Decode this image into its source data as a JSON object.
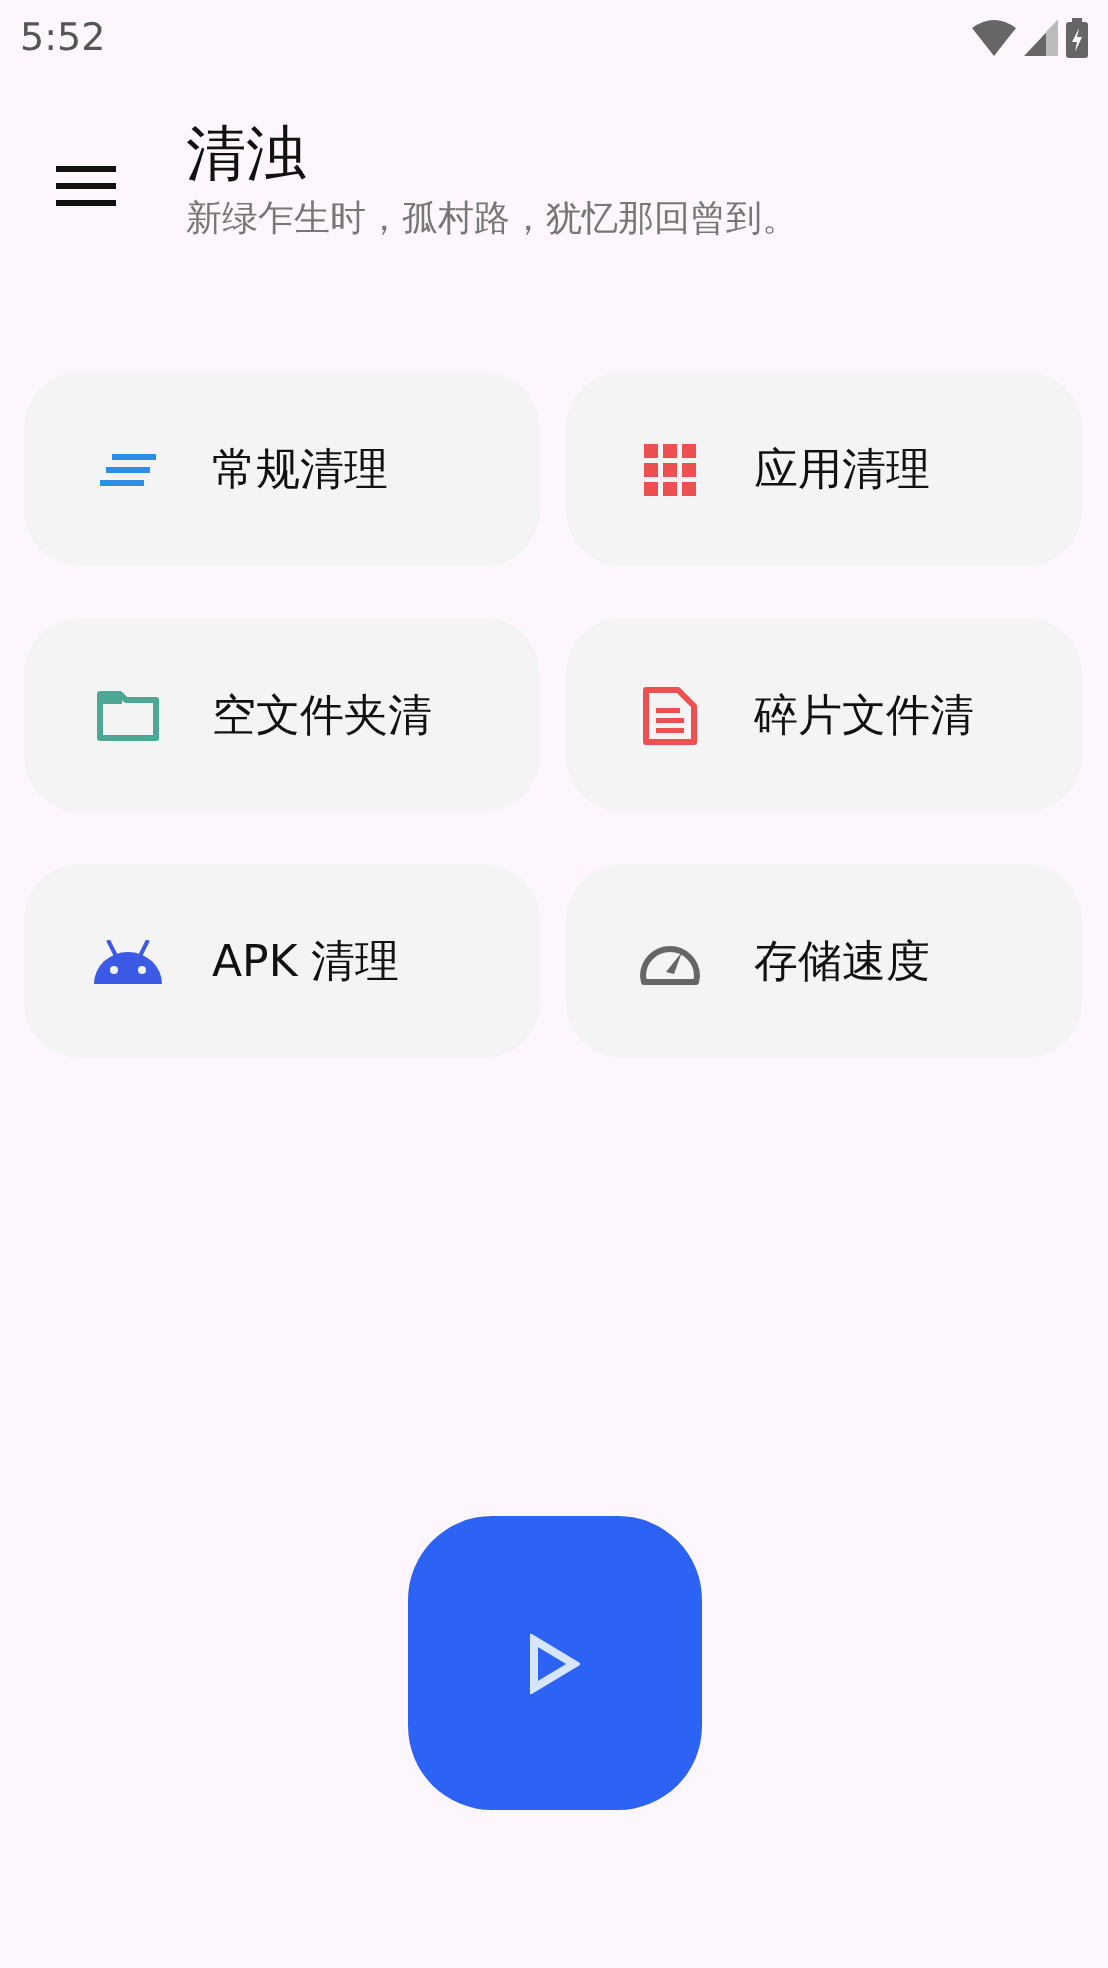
{
  "status_bar": {
    "time": "5:52"
  },
  "header": {
    "title": "清浊",
    "subtitle": "新绿乍生时，孤村路，犹忆那回曾到。"
  },
  "tiles": [
    {
      "label": "常规清理"
    },
    {
      "label": "应用清理"
    },
    {
      "label": "空文件夹清"
    },
    {
      "label": "碎片文件清"
    },
    {
      "label": "APK 清理"
    },
    {
      "label": "存储速度"
    }
  ]
}
